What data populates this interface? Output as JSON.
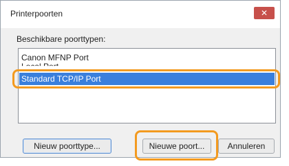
{
  "window": {
    "title": "Printerpoorten",
    "close_symbol": "✕"
  },
  "port_types": {
    "label": "Beschikbare poorttypen:",
    "items": [
      {
        "label": "Canon MFNP Port"
      },
      {
        "label": "Local Port"
      },
      {
        "label": "Standard TCP/IP Port"
      }
    ],
    "selected_index": 2
  },
  "buttons": {
    "new_port_type": "Nieuw poorttype...",
    "new_port": "Nieuwe poort...",
    "cancel": "Annuleren"
  },
  "colors": {
    "selection": "#3a7fdc",
    "highlight_ring": "#f39a1f",
    "close_button": "#c7504b"
  }
}
